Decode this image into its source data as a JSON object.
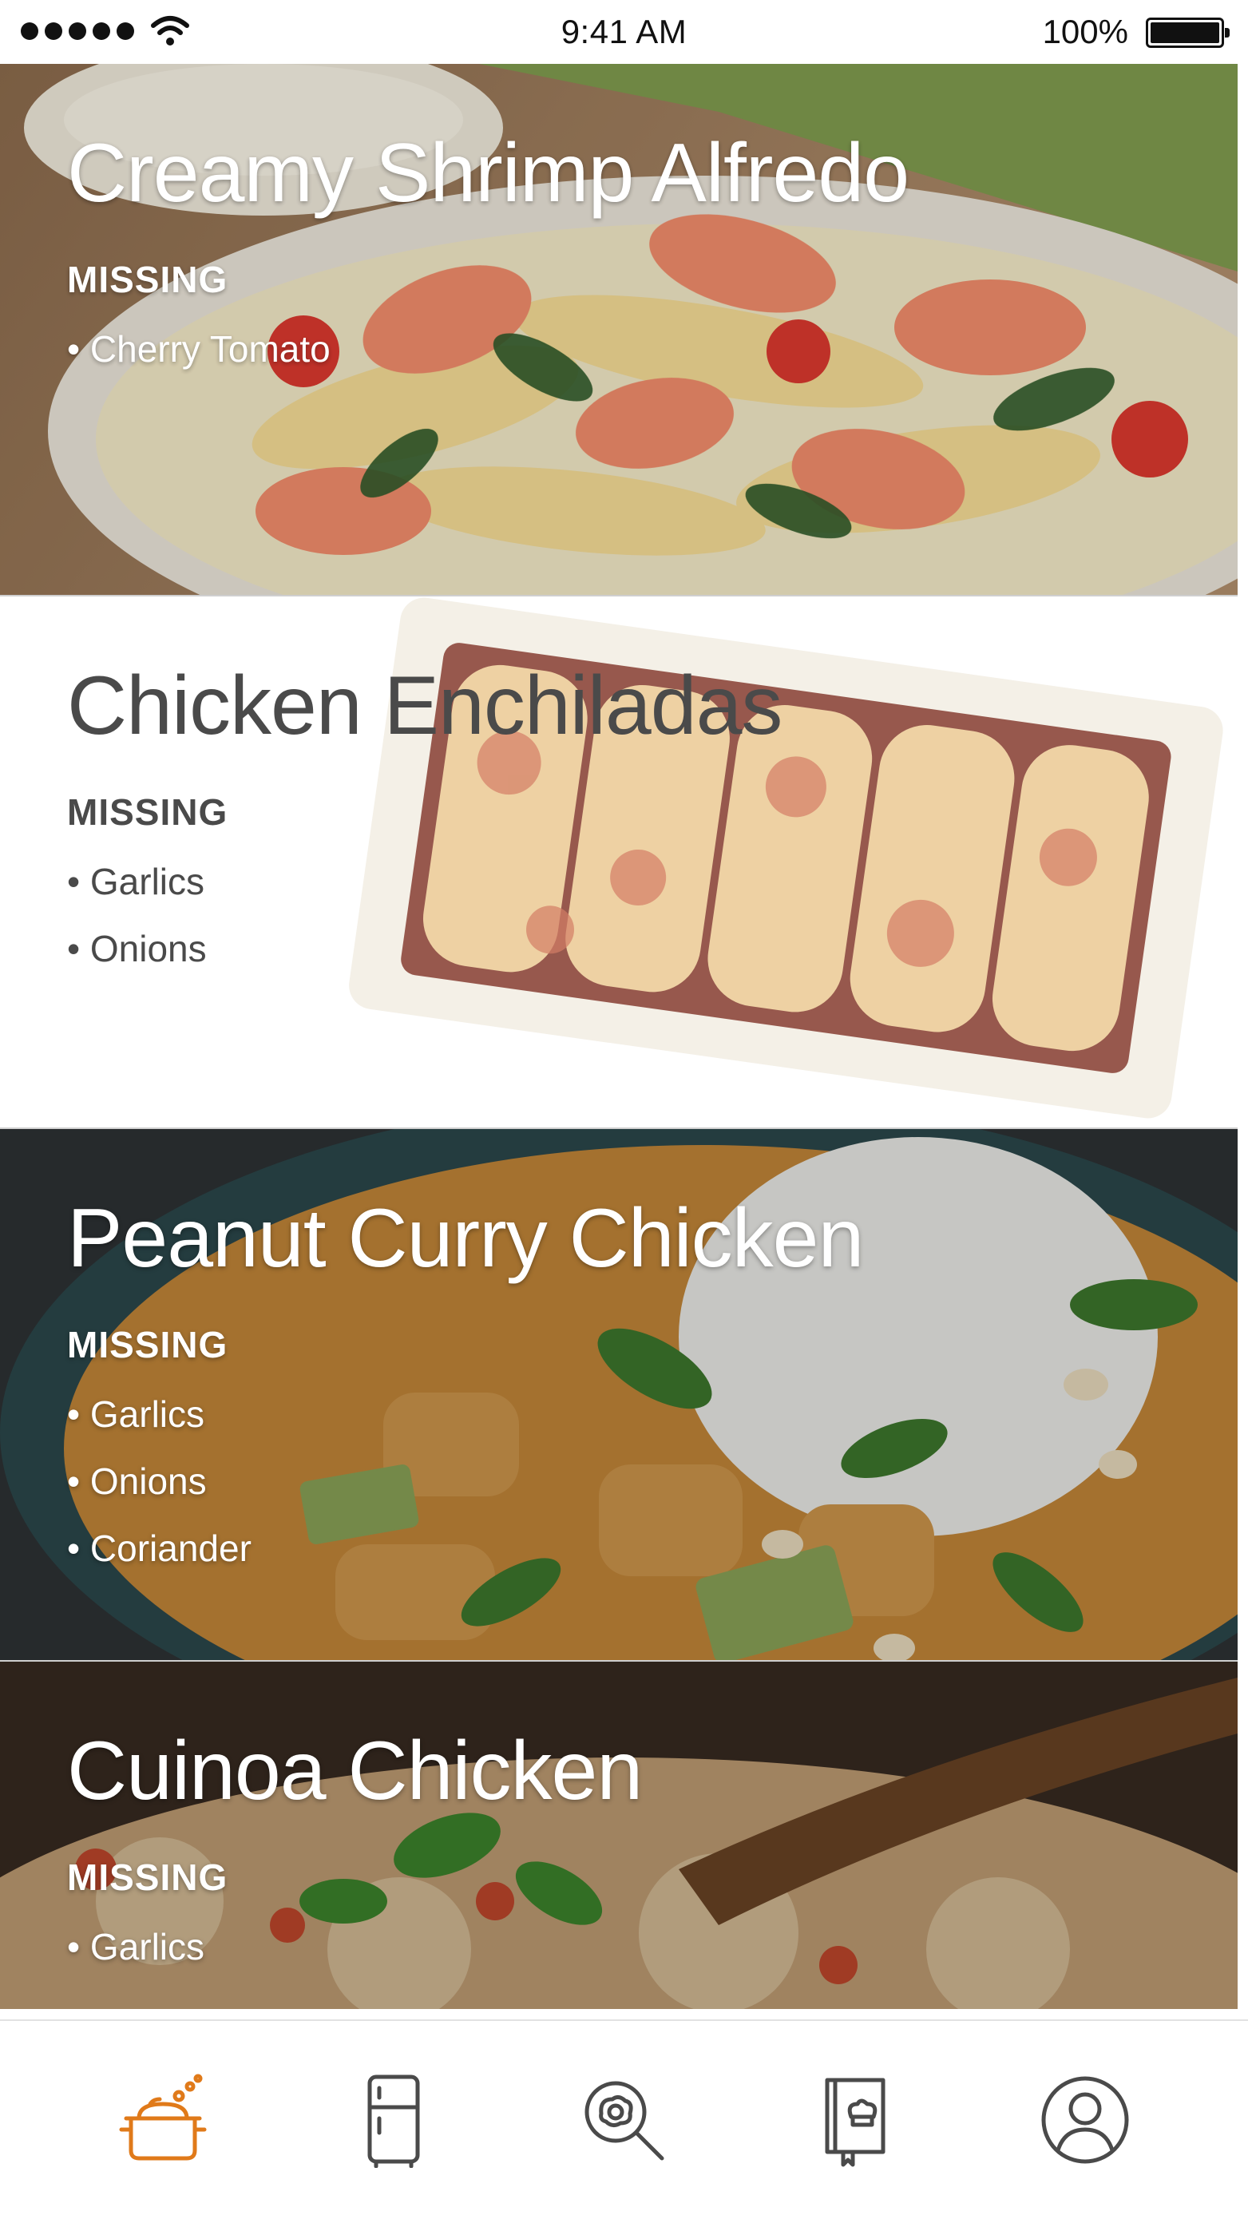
{
  "status_bar": {
    "time": "9:41 AM",
    "battery": "100%"
  },
  "recipes": [
    {
      "title": "Creamy Shrimp Alfredo",
      "missing_label": "MISSING",
      "missing": [
        "Cherry Tomato"
      ],
      "image": "shrimp-alfredo-photo"
    },
    {
      "title": "Chicken Enchiladas",
      "missing_label": "MISSING",
      "missing": [
        "Garlics",
        "Onions"
      ],
      "image": "enchiladas-photo"
    },
    {
      "title": "Peanut Curry Chicken",
      "missing_label": "MISSING",
      "missing": [
        "Garlics",
        "Onions",
        "Coriander"
      ],
      "image": "curry-photo"
    },
    {
      "title": "Cuinoa Chicken",
      "missing_label": "MISSING",
      "missing": [
        "Garlics"
      ],
      "image": "quinoa-photo"
    }
  ],
  "tab_bar": {
    "tabs": [
      {
        "icon": "cooking-pot-icon",
        "active": true
      },
      {
        "icon": "fridge-icon",
        "active": false
      },
      {
        "icon": "search-recipe-icon",
        "active": false
      },
      {
        "icon": "cookbook-icon",
        "active": false
      },
      {
        "icon": "profile-icon",
        "active": false
      }
    ]
  },
  "colors": {
    "accent": "#e07a1a",
    "icon_inactive": "#4a4a4a",
    "dark_text": "#4a4a4a"
  }
}
